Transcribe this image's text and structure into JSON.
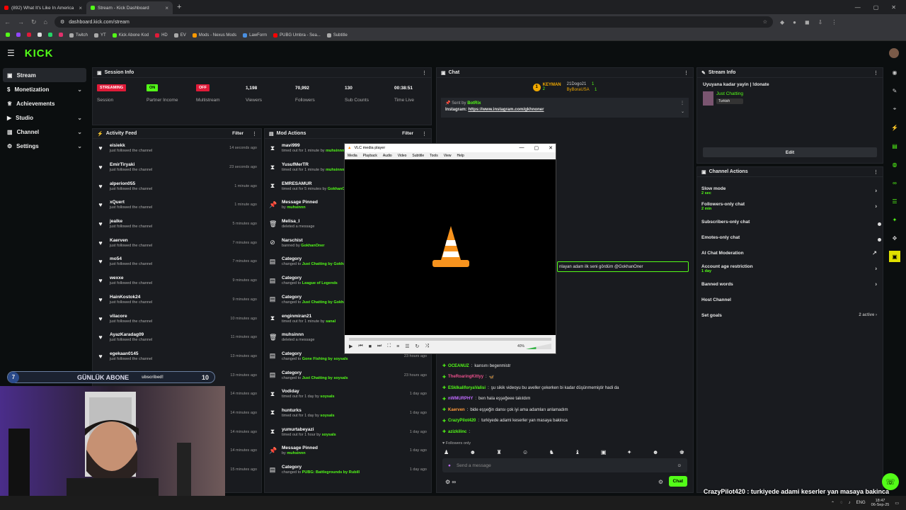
{
  "browser": {
    "tabs": [
      {
        "title": "(892) What It's Like In America",
        "active": false
      },
      {
        "title": "Stream - Kick Dashboard",
        "active": true
      }
    ],
    "url": "dashboard.kick.com/stream",
    "bookmarks": [
      "Twitch",
      "YT",
      "Kick Abone Kod",
      "HD",
      "EV",
      "Mods - Nexus Mods",
      "LawForm",
      "PUBG Umbra - Sea...",
      "Subtitle"
    ]
  },
  "app": {
    "logo": "KICK"
  },
  "sidebar": {
    "items": [
      {
        "label": "Stream"
      },
      {
        "label": "Monetization"
      },
      {
        "label": "Achievements"
      },
      {
        "label": "Studio"
      },
      {
        "label": "Channel"
      },
      {
        "label": "Settings"
      }
    ]
  },
  "session": {
    "title": "Session Info",
    "stats": [
      {
        "value": "STREAMING",
        "label": "Session"
      },
      {
        "value": "ON",
        "label": "Partner Income"
      },
      {
        "value": "OFF",
        "label": "Multistream"
      },
      {
        "value": "1,198",
        "label": "Viewers"
      },
      {
        "value": "70,992",
        "label": "Followers"
      },
      {
        "value": "130",
        "label": "Sub Counts"
      },
      {
        "value": "00:38:51",
        "label": "Time Live"
      }
    ]
  },
  "activity": {
    "title": "Activity Feed",
    "filter": "Filter",
    "items": [
      {
        "name": "eisiekk",
        "sub": "just followed the channel",
        "time": "14 seconds ago"
      },
      {
        "name": "EmirTiryaki",
        "sub": "just followed the channel",
        "time": "23 seconds ago"
      },
      {
        "name": "alperion055",
        "sub": "just followed the channel",
        "time": "1 minute ago"
      },
      {
        "name": "xQuert",
        "sub": "just followed the channel",
        "time": "1 minute ago"
      },
      {
        "name": "jealke",
        "sub": "just followed the channel",
        "time": "5 minutes ago"
      },
      {
        "name": "Kaerven",
        "sub": "just followed the channel",
        "time": "7 minutes ago"
      },
      {
        "name": "mo54",
        "sub": "just followed the channel",
        "time": "7 minutes ago"
      },
      {
        "name": "wexxe",
        "sub": "just followed the channel",
        "time": "9 minutes ago"
      },
      {
        "name": "HainKostok24",
        "sub": "just followed the channel",
        "time": "9 minutes ago"
      },
      {
        "name": "vilacore",
        "sub": "just followed the channel",
        "time": "10 minutes ago"
      },
      {
        "name": "AyazKaradag09",
        "sub": "just followed the channel",
        "time": "11 minutes ago"
      },
      {
        "name": "egekaan0145",
        "sub": "just followed the channel",
        "time": "13 minutes ago"
      },
      {
        "name": "",
        "sub": "",
        "time": "13 minutes ago"
      },
      {
        "name": "",
        "sub": "",
        "time": "14 minutes ago"
      },
      {
        "name": "",
        "sub": "",
        "time": "14 minutes ago"
      },
      {
        "name": "",
        "sub": "",
        "time": "14 minutes ago"
      },
      {
        "name": "",
        "sub": "",
        "time": "14 minutes ago"
      },
      {
        "name": "",
        "sub": "",
        "time": "15 minutes ago"
      }
    ]
  },
  "mod": {
    "title": "Mod Actions",
    "filter": "Filter",
    "items": [
      {
        "icon": "⧗",
        "name": "mavi999",
        "pre": "timed out for 1 minute by ",
        "by": "muhsinnn",
        "time": ""
      },
      {
        "icon": "⧗",
        "name": "YusufMerTR",
        "pre": "timed out for 1 minute by ",
        "by": "muhsinnn",
        "time": ""
      },
      {
        "icon": "⧗",
        "name": "EMRESAMUR",
        "pre": "timed out for 5 minutes by ",
        "by": "GokhanOner",
        "time": ""
      },
      {
        "icon": "📌",
        "name": "Message Pinned",
        "pre": "by ",
        "by": "muhsinnn",
        "time": ""
      },
      {
        "icon": "🗑",
        "name": "Melisa_I",
        "pre": "deleted a message",
        "by": "",
        "time": ""
      },
      {
        "icon": "⊘",
        "name": "Narschist",
        "pre": "banned by ",
        "by": "GokhanOner",
        "time": ""
      },
      {
        "icon": "▤",
        "name": "Category",
        "pre": "changed to ",
        "by": "Just Chatting by GokhanOner",
        "time": ""
      },
      {
        "icon": "▤",
        "name": "Category",
        "pre": "changed to ",
        "by": "League of Legends",
        "time": ""
      },
      {
        "icon": "▤",
        "name": "Category",
        "pre": "changed to ",
        "by": "Just Chatting by GokhanOner",
        "time": ""
      },
      {
        "icon": "⧗",
        "name": "enginmiran21",
        "pre": "timed out for 1 minute by ",
        "by": "sanal",
        "time": ""
      },
      {
        "icon": "🗑",
        "name": "muhsinnn",
        "pre": "deleted a message",
        "by": "",
        "time": ""
      },
      {
        "icon": "▤",
        "name": "Category",
        "pre": "changed to ",
        "by": "Gone Fishing by soysals",
        "time": "23 hours ago"
      },
      {
        "icon": "▤",
        "name": "Category",
        "pre": "changed to ",
        "by": "Just Chatting by soysals",
        "time": "23 hours ago"
      },
      {
        "icon": "⧗",
        "name": "Vodiday",
        "pre": "timed out for 1 day by ",
        "by": "soysals",
        "time": "1 day ago"
      },
      {
        "icon": "⧗",
        "name": "hunturks",
        "pre": "timed out for 1 day by ",
        "by": "soysals",
        "time": "1 day ago"
      },
      {
        "icon": "⧗",
        "name": "yumurtabeyazi",
        "pre": "timed out for 1 hour by ",
        "by": "soysals",
        "time": "1 day ago"
      },
      {
        "icon": "📌",
        "name": "Message Pinned",
        "pre": "by ",
        "by": "muhsinnn",
        "time": "1 day ago"
      },
      {
        "icon": "▤",
        "name": "Category",
        "pre": "changed to ",
        "by": "PUBG: Battlegrounds by Rubill",
        "time": "1 day ago"
      }
    ]
  },
  "chat": {
    "title": "Chat",
    "leaderboard": [
      {
        "rank": "1",
        "name": "KEYMAN",
        "count": "2"
      },
      {
        "rank": "",
        "name": "21Dogo21",
        "count": "1"
      },
      {
        "rank": "",
        "name": "ByBoraUSA",
        "count": "1"
      }
    ],
    "pinned": {
      "sent_by": "Sent by",
      "sender": "BotRix",
      "text": "Instagram:",
      "link": "https://www.instagram.com/gkhnoner"
    },
    "highlight": "nlayan adam ilk seni gördüm @GokhanOner",
    "messages": [
      {
        "user": "OCEANUZ",
        "color": "#53fc18",
        "text": "karısını begenmistr"
      },
      {
        "user": "TheRoaringKittyy",
        "color": "#e94f8b",
        "text": "🦋"
      },
      {
        "user": "ESkIkaliforyaValisi",
        "color": "#53fc18",
        "text": "şu sikik videoyu bu aveller çekerken bi kadar düşünmemiştir hadi da"
      },
      {
        "user": "nWMURPHY",
        "color": "#c06bff",
        "text": "ben hala eşşeğeee takıldım"
      },
      {
        "user": "Kaerven",
        "color": "#ff9a3c",
        "text": "bide eşşeğin dansı çok iyi ama adamları anlamadım"
      },
      {
        "user": "CrazyPilot420",
        "color": "#53fc18",
        "text": "turkiyede adami keserler yan masaya bakinca"
      },
      {
        "user": "azizkilinc",
        "color": "#53fc18",
        "text": ""
      }
    ],
    "followers_only": "Followers only",
    "input_placeholder": "Send a message",
    "send": "Chat"
  },
  "stream_info": {
    "title": "Stream Info",
    "stream_title": "Uyuyana kadar yayin | !donate",
    "category": "Just Chatting",
    "language": "Turkish",
    "edit": "Edit"
  },
  "channel_actions": {
    "title": "Channel Actions",
    "items": [
      {
        "label": "Slow mode",
        "sub": "2 sec",
        "right": "›"
      },
      {
        "label": "Followers-only chat",
        "sub": "2 min",
        "right": "›"
      },
      {
        "label": "Subscribers-only chat",
        "sub": "",
        "right": "toggle"
      },
      {
        "label": "Emotes-only chat",
        "sub": "",
        "right": "toggle"
      },
      {
        "label": "AI Chat Moderation",
        "sub": "",
        "right": "↗"
      },
      {
        "label": "Account age restriction",
        "sub": "1 day",
        "right": "›"
      },
      {
        "label": "Banned words",
        "sub": "",
        "right": "›"
      },
      {
        "label": "Host Channel",
        "sub": "",
        "right": ""
      },
      {
        "label": "Set goals",
        "sub": "",
        "right": "2 active ›"
      }
    ]
  },
  "vlc": {
    "title": "VLC media player",
    "menu": [
      "Media",
      "Playback",
      "Audio",
      "Video",
      "Subtitle",
      "Tools",
      "View",
      "Help"
    ],
    "volume": "40%"
  },
  "overlay": {
    "abone_left": "7",
    "abone_label": "GÜNLÜK ABONE",
    "abone_right": "10",
    "abone_partial": "ubscribed!",
    "bottom_msg_user": "CrazyPilot420",
    "bottom_msg_text": "turkiyede adami keserler yan masaya bakinca",
    "bottom_user2": "azizkilinc"
  },
  "taskbar": {
    "lang": "ENG",
    "time": "18:47",
    "date": "06-Sep-25"
  },
  "colors": {
    "accent": "#53fc18",
    "panel": "#191b1f",
    "bg": "#0b0e0f",
    "streaming": "#e01a38"
  }
}
